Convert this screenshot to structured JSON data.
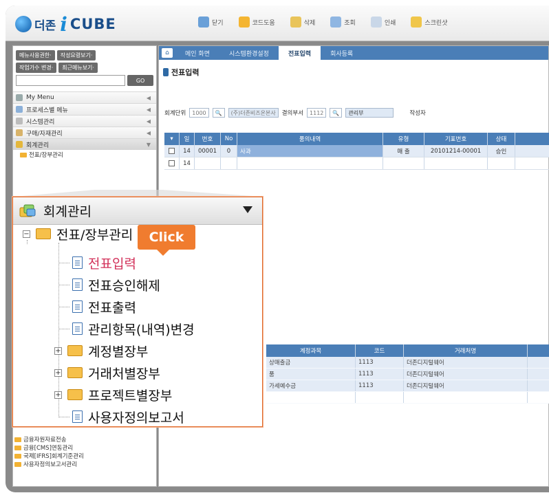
{
  "app": {
    "logo_text_a": "더존",
    "logo_text_b": "i",
    "logo_text_c": "CUBE"
  },
  "toolbar": {
    "items": [
      "닫기",
      "코드도움",
      "삭제",
      "조회",
      "인쇄",
      "스크린샷"
    ]
  },
  "sidebar": {
    "buttons_row1": [
      "메뉴사용권한·",
      "작성요령보기·"
    ],
    "buttons_row2": [
      "작업가수 변경·",
      "최근메뉴보기·"
    ],
    "go_label": "GO",
    "items": [
      {
        "label": "My Menu"
      },
      {
        "label": "프로세스별 메뉴"
      },
      {
        "label": "시스템관리"
      },
      {
        "label": "구매/자재관리"
      },
      {
        "label": "회계관리"
      }
    ],
    "sub_item": "전표/장부관리",
    "bottom_tree": [
      "금융자원자료전송",
      "금융[CMS]연동관리",
      "국제[IFRS]회계기준관리",
      "사용자정의보고서관리"
    ]
  },
  "tabs": [
    "메인 화면",
    "시스템환경설정",
    "전표입력",
    "회사등록"
  ],
  "page": {
    "title": "전표입력",
    "unit_label": "회계단위",
    "unit_code": "1000",
    "unit_name": "(주)더존비즈온본사",
    "dept_label": "결의부서",
    "dept_code": "1112",
    "dept_name": "관리부",
    "writer_label": "작성자"
  },
  "grid": {
    "headers": [
      "일",
      "번호",
      "No",
      "품의내역",
      "유형",
      "기표번호",
      "상태"
    ],
    "rows": [
      {
        "day": "14",
        "num": "00001",
        "no": "0",
        "desc": "사과",
        "type": "매 출",
        "slip": "20101214-00001",
        "status": "승인"
      },
      {
        "day": "14",
        "num": "",
        "no": "",
        "desc": "",
        "type": "",
        "slip": "",
        "status": ""
      }
    ]
  },
  "grid2": {
    "headers": [
      "계정과목",
      "코드",
      "거래처명"
    ],
    "rows": [
      {
        "account": "상매출금",
        "code": "1113",
        "client": "더존디지털웨어"
      },
      {
        "account": "품",
        "code": "1113",
        "client": "더존디지털웨어"
      },
      {
        "account": "가세예수금",
        "code": "1113",
        "client": "더존디지털웨어"
      }
    ]
  },
  "popup": {
    "title": "회계관리",
    "root": "전표/장부관리",
    "children": [
      "전표입력",
      "전표승인해제",
      "전표출력",
      "관리항목(내역)변경"
    ],
    "folders": [
      "계정별장부",
      "거래처별장부",
      "프로젝트별장부"
    ],
    "last": "사용자정의보고서",
    "click_label": "Click"
  },
  "colors": {
    "accent": "#4a7eb7",
    "highlight": "#d2315a",
    "callout": "#f07c2f"
  }
}
